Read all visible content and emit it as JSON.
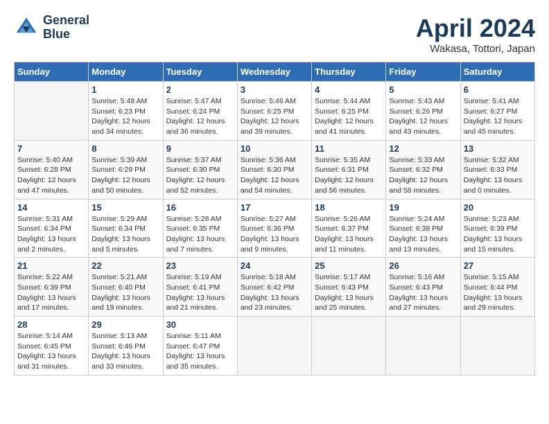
{
  "header": {
    "logo_line1": "General",
    "logo_line2": "Blue",
    "title": "April 2024",
    "location": "Wakasa, Tottori, Japan"
  },
  "calendar": {
    "weekdays": [
      "Sunday",
      "Monday",
      "Tuesday",
      "Wednesday",
      "Thursday",
      "Friday",
      "Saturday"
    ],
    "weeks": [
      [
        {
          "day": "",
          "sunrise": "",
          "sunset": "",
          "daylight": "",
          "empty": true
        },
        {
          "day": "1",
          "sunrise": "Sunrise: 5:48 AM",
          "sunset": "Sunset: 6:23 PM",
          "daylight": "Daylight: 12 hours and 34 minutes."
        },
        {
          "day": "2",
          "sunrise": "Sunrise: 5:47 AM",
          "sunset": "Sunset: 6:24 PM",
          "daylight": "Daylight: 12 hours and 36 minutes."
        },
        {
          "day": "3",
          "sunrise": "Sunrise: 5:46 AM",
          "sunset": "Sunset: 6:25 PM",
          "daylight": "Daylight: 12 hours and 39 minutes."
        },
        {
          "day": "4",
          "sunrise": "Sunrise: 5:44 AM",
          "sunset": "Sunset: 6:25 PM",
          "daylight": "Daylight: 12 hours and 41 minutes."
        },
        {
          "day": "5",
          "sunrise": "Sunrise: 5:43 AM",
          "sunset": "Sunset: 6:26 PM",
          "daylight": "Daylight: 12 hours and 43 minutes."
        },
        {
          "day": "6",
          "sunrise": "Sunrise: 5:41 AM",
          "sunset": "Sunset: 6:27 PM",
          "daylight": "Daylight: 12 hours and 45 minutes."
        }
      ],
      [
        {
          "day": "7",
          "sunrise": "Sunrise: 5:40 AM",
          "sunset": "Sunset: 6:28 PM",
          "daylight": "Daylight: 12 hours and 47 minutes."
        },
        {
          "day": "8",
          "sunrise": "Sunrise: 5:39 AM",
          "sunset": "Sunset: 6:29 PM",
          "daylight": "Daylight: 12 hours and 50 minutes."
        },
        {
          "day": "9",
          "sunrise": "Sunrise: 5:37 AM",
          "sunset": "Sunset: 6:30 PM",
          "daylight": "Daylight: 12 hours and 52 minutes."
        },
        {
          "day": "10",
          "sunrise": "Sunrise: 5:36 AM",
          "sunset": "Sunset: 6:30 PM",
          "daylight": "Daylight: 12 hours and 54 minutes."
        },
        {
          "day": "11",
          "sunrise": "Sunrise: 5:35 AM",
          "sunset": "Sunset: 6:31 PM",
          "daylight": "Daylight: 12 hours and 56 minutes."
        },
        {
          "day": "12",
          "sunrise": "Sunrise: 5:33 AM",
          "sunset": "Sunset: 6:32 PM",
          "daylight": "Daylight: 12 hours and 58 minutes."
        },
        {
          "day": "13",
          "sunrise": "Sunrise: 5:32 AM",
          "sunset": "Sunset: 6:33 PM",
          "daylight": "Daylight: 13 hours and 0 minutes."
        }
      ],
      [
        {
          "day": "14",
          "sunrise": "Sunrise: 5:31 AM",
          "sunset": "Sunset: 6:34 PM",
          "daylight": "Daylight: 13 hours and 2 minutes."
        },
        {
          "day": "15",
          "sunrise": "Sunrise: 5:29 AM",
          "sunset": "Sunset: 6:34 PM",
          "daylight": "Daylight: 13 hours and 5 minutes."
        },
        {
          "day": "16",
          "sunrise": "Sunrise: 5:28 AM",
          "sunset": "Sunset: 6:35 PM",
          "daylight": "Daylight: 13 hours and 7 minutes."
        },
        {
          "day": "17",
          "sunrise": "Sunrise: 5:27 AM",
          "sunset": "Sunset: 6:36 PM",
          "daylight": "Daylight: 13 hours and 9 minutes."
        },
        {
          "day": "18",
          "sunrise": "Sunrise: 5:26 AM",
          "sunset": "Sunset: 6:37 PM",
          "daylight": "Daylight: 13 hours and 11 minutes."
        },
        {
          "day": "19",
          "sunrise": "Sunrise: 5:24 AM",
          "sunset": "Sunset: 6:38 PM",
          "daylight": "Daylight: 13 hours and 13 minutes."
        },
        {
          "day": "20",
          "sunrise": "Sunrise: 5:23 AM",
          "sunset": "Sunset: 6:39 PM",
          "daylight": "Daylight: 13 hours and 15 minutes."
        }
      ],
      [
        {
          "day": "21",
          "sunrise": "Sunrise: 5:22 AM",
          "sunset": "Sunset: 6:39 PM",
          "daylight": "Daylight: 13 hours and 17 minutes."
        },
        {
          "day": "22",
          "sunrise": "Sunrise: 5:21 AM",
          "sunset": "Sunset: 6:40 PM",
          "daylight": "Daylight: 13 hours and 19 minutes."
        },
        {
          "day": "23",
          "sunrise": "Sunrise: 5:19 AM",
          "sunset": "Sunset: 6:41 PM",
          "daylight": "Daylight: 13 hours and 21 minutes."
        },
        {
          "day": "24",
          "sunrise": "Sunrise: 5:18 AM",
          "sunset": "Sunset: 6:42 PM",
          "daylight": "Daylight: 13 hours and 23 minutes."
        },
        {
          "day": "25",
          "sunrise": "Sunrise: 5:17 AM",
          "sunset": "Sunset: 6:43 PM",
          "daylight": "Daylight: 13 hours and 25 minutes."
        },
        {
          "day": "26",
          "sunrise": "Sunrise: 5:16 AM",
          "sunset": "Sunset: 6:43 PM",
          "daylight": "Daylight: 13 hours and 27 minutes."
        },
        {
          "day": "27",
          "sunrise": "Sunrise: 5:15 AM",
          "sunset": "Sunset: 6:44 PM",
          "daylight": "Daylight: 13 hours and 29 minutes."
        }
      ],
      [
        {
          "day": "28",
          "sunrise": "Sunrise: 5:14 AM",
          "sunset": "Sunset: 6:45 PM",
          "daylight": "Daylight: 13 hours and 31 minutes."
        },
        {
          "day": "29",
          "sunrise": "Sunrise: 5:13 AM",
          "sunset": "Sunset: 6:46 PM",
          "daylight": "Daylight: 13 hours and 33 minutes."
        },
        {
          "day": "30",
          "sunrise": "Sunrise: 5:11 AM",
          "sunset": "Sunset: 6:47 PM",
          "daylight": "Daylight: 13 hours and 35 minutes."
        },
        {
          "day": "",
          "sunrise": "",
          "sunset": "",
          "daylight": "",
          "empty": true
        },
        {
          "day": "",
          "sunrise": "",
          "sunset": "",
          "daylight": "",
          "empty": true
        },
        {
          "day": "",
          "sunrise": "",
          "sunset": "",
          "daylight": "",
          "empty": true
        },
        {
          "day": "",
          "sunrise": "",
          "sunset": "",
          "daylight": "",
          "empty": true
        }
      ]
    ]
  }
}
